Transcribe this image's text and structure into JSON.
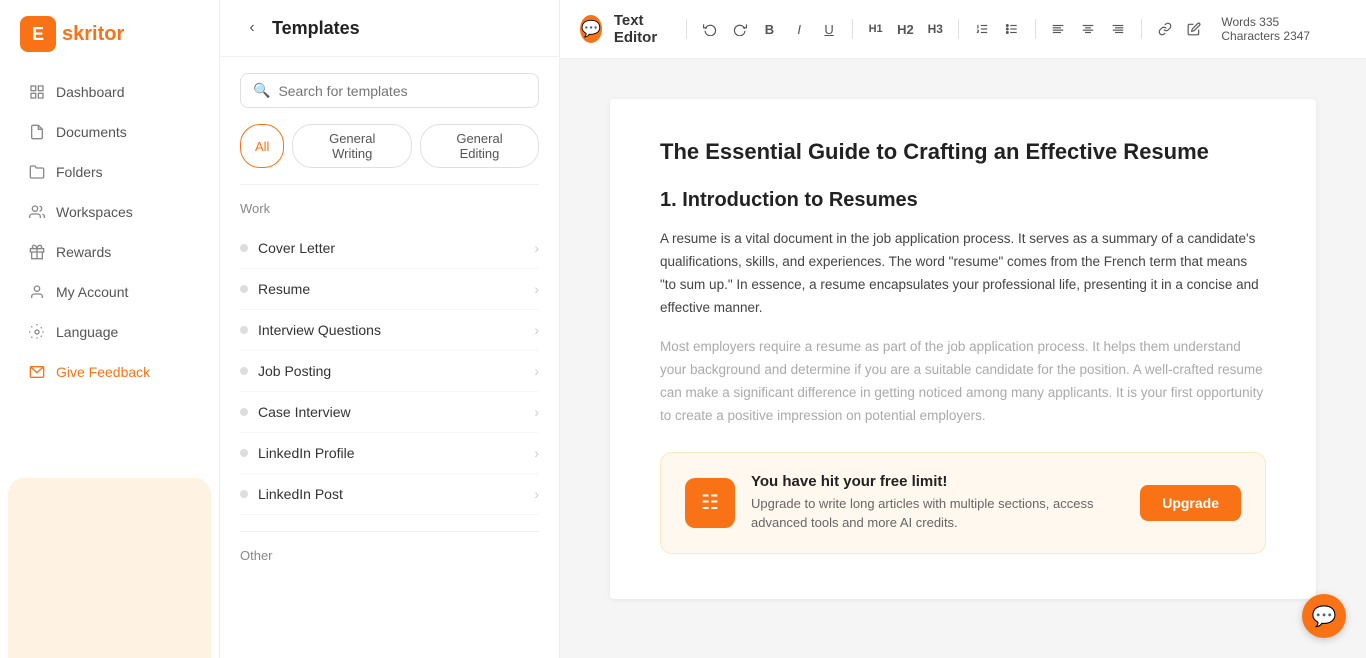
{
  "app": {
    "name": "Eskritor",
    "logo_letter": "E"
  },
  "sidebar": {
    "nav_items": [
      {
        "id": "dashboard",
        "label": "Dashboard",
        "icon": "grid"
      },
      {
        "id": "documents",
        "label": "Documents",
        "icon": "file"
      },
      {
        "id": "folders",
        "label": "Folders",
        "icon": "folder"
      },
      {
        "id": "workspaces",
        "label": "Workspaces",
        "icon": "users"
      },
      {
        "id": "rewards",
        "label": "Rewards",
        "icon": "gift"
      },
      {
        "id": "my-account",
        "label": "My Account",
        "icon": "user"
      },
      {
        "id": "language",
        "label": "Language",
        "icon": "settings"
      },
      {
        "id": "give-feedback",
        "label": "Give Feedback",
        "icon": "envelope",
        "special": true
      }
    ]
  },
  "templates_panel": {
    "title": "Templates",
    "back_label": "‹",
    "search_placeholder": "Search for templates",
    "filter_tabs": [
      {
        "id": "all",
        "label": "All",
        "active": true
      },
      {
        "id": "general-writing",
        "label": "General Writing",
        "active": false
      },
      {
        "id": "general-editing",
        "label": "General Editing",
        "active": false
      }
    ],
    "sections": [
      {
        "id": "work",
        "title": "Work",
        "items": [
          {
            "id": "cover-letter",
            "label": "Cover Letter"
          },
          {
            "id": "resume",
            "label": "Resume"
          },
          {
            "id": "interview-questions",
            "label": "Interview Questions"
          },
          {
            "id": "job-posting",
            "label": "Job Posting"
          },
          {
            "id": "case-interview",
            "label": "Case Interview"
          },
          {
            "id": "linkedin-profile",
            "label": "LinkedIn Profile"
          },
          {
            "id": "linkedin-post",
            "label": "LinkedIn Post"
          }
        ]
      },
      {
        "id": "other",
        "title": "Other",
        "items": []
      }
    ]
  },
  "toolbar": {
    "title": "Text Editor",
    "buttons": [
      "undo",
      "redo",
      "bold",
      "italic",
      "underline",
      "h1",
      "h2",
      "h3",
      "list-ol",
      "list-ul",
      "align-left",
      "align-center",
      "align-right",
      "link",
      "edit"
    ],
    "words_label": "Words",
    "words_count": "335",
    "chars_label": "Characters",
    "chars_count": "2347"
  },
  "editor": {
    "doc_title": "The Essential Guide to Crafting an Effective Resume",
    "section_title": "1. Introduction to Resumes",
    "paragraph1": "A resume is a vital document in the job application process. It serves as a summary of a candidate's qualifications, skills, and experiences. The word \"resume\" comes from the French term that means \"to sum up.\" In essence, a resume encapsulates your professional life, presenting it in a concise and effective manner.",
    "paragraph2": "Most employers require a resume as part of the job application process. It helps them understand your background and determine if you are a suitable candidate for the position. A well-crafted resume can make a significant difference in getting noticed among many applicants. It is your first opportunity to create a positive impression on potential employers.",
    "upgrade_banner": {
      "heading": "You have hit your free limit!",
      "subtext": "Upgrade to write long articles with multiple sections, access advanced tools and more AI credits.",
      "btn_label": "Upgrade",
      "icon": "E"
    }
  }
}
